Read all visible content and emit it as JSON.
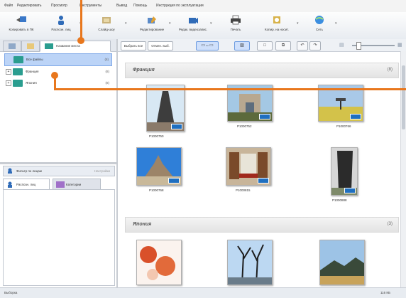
{
  "menu": {
    "items": [
      "Файл",
      "Редактировать",
      "Просмотр",
      "Инструменты",
      "Вывод",
      "Помощь",
      "Инструкция по эксплуатации"
    ]
  },
  "toolbar": {
    "buttons": [
      {
        "label": "Копировать в ПК",
        "icon": "copy-to-pc-icon"
      },
      {
        "label": "Распозн. лиц",
        "icon": "face-recognition-icon"
      },
      {
        "label": "Слайд-шоу",
        "icon": "slideshow-icon"
      },
      {
        "label": "Редактирование",
        "icon": "edit-icon"
      },
      {
        "label": "Редак. видеозапис.",
        "icon": "video-edit-icon"
      },
      {
        "label": "Печать",
        "icon": "print-icon"
      },
      {
        "label": "Копир. на носит.",
        "icon": "copy-to-media-icon"
      },
      {
        "label": "Сеть",
        "icon": "network-icon"
      }
    ]
  },
  "left_pane": {
    "active_tab": "Название места",
    "tree": [
      {
        "label": "Все файлы",
        "count": "(8)",
        "selected": true
      },
      {
        "label": "Франция",
        "count": "(8)"
      },
      {
        "label": "Япония",
        "count": "(8)"
      }
    ],
    "lower_bar": {
      "label": "Фильтр по лицам",
      "right": "Настройки"
    },
    "lower_tabs": [
      {
        "label": "Распозн. лиц",
        "active": true
      },
      {
        "label": "Категории"
      }
    ]
  },
  "view_toolbar": {
    "select_all": "Выбрать все",
    "deselect_all": "Отмен. выб."
  },
  "groups": [
    {
      "title": "Франция",
      "count_icon": "(8)",
      "photos": [
        {
          "caption": "P1000750",
          "colors": [
            "#cfe3f3",
            "#3d3d3d",
            "#8a7a6a"
          ]
        },
        {
          "caption": "P1000752",
          "colors": [
            "#9fc4e2",
            "#b8a890",
            "#5c6a3c"
          ]
        },
        {
          "caption": "P1000766",
          "colors": [
            "#a9c9e8",
            "#d3c24a",
            "#6c7a4a"
          ]
        },
        {
          "caption": "P1000768",
          "colors": [
            "#2f7fd8",
            "#9c8468",
            "#c9b99a"
          ]
        },
        {
          "caption": "P1000815",
          "colors": [
            "#7a4a2a",
            "#c8b59a",
            "#a0281c"
          ]
        },
        {
          "caption": "P1000888",
          "colors": [
            "#d6d6d6",
            "#2b2b2b",
            "#7e8a6a"
          ]
        }
      ]
    },
    {
      "title": "Япония",
      "count_icon": "(3)",
      "photos": [
        {
          "caption": "",
          "colors": [
            "#ffffff",
            "#d9502a",
            "#f3c7b0"
          ]
        },
        {
          "caption": "",
          "colors": [
            "#bcd8f2",
            "#1d1d1d",
            "#6a7c8a"
          ]
        },
        {
          "caption": "",
          "colors": [
            "#9dc3e6",
            "#3a4a3a",
            "#c8a35a"
          ]
        }
      ]
    }
  ],
  "statusbar": {
    "left": "Выборка",
    "right": "116 КБ"
  },
  "colors": {
    "accent": "#e8771d",
    "selection": "#bcd4f7"
  }
}
